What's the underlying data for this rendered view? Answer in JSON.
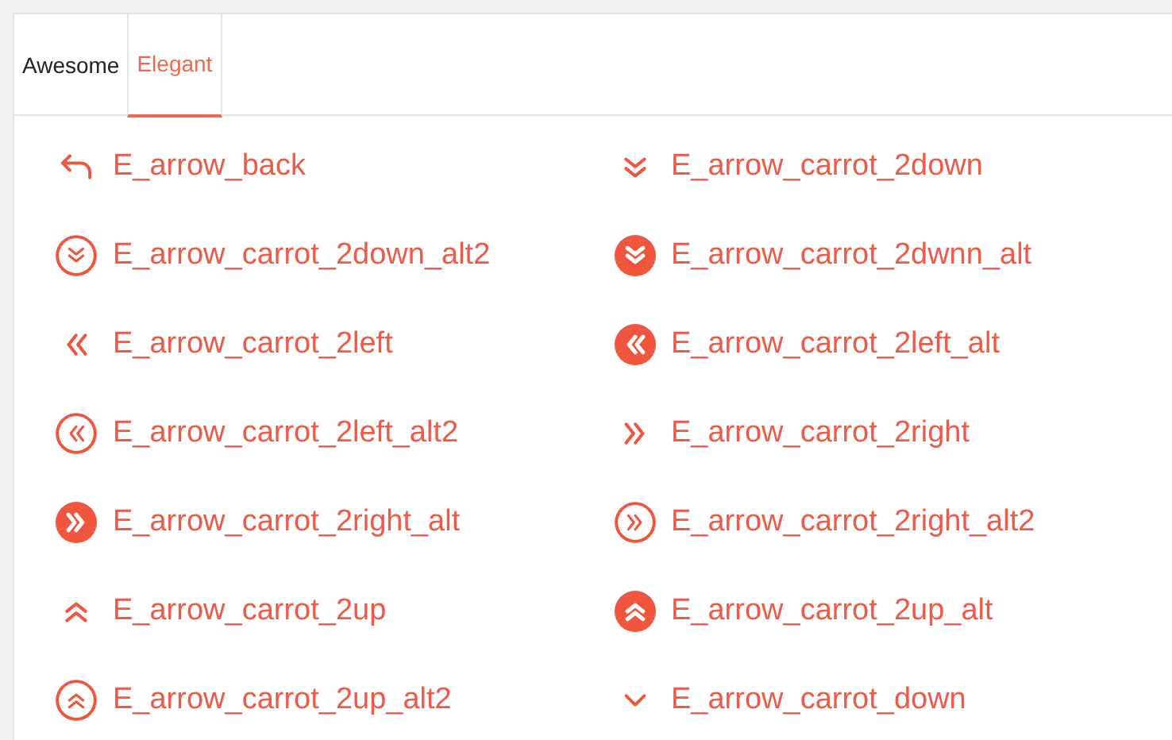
{
  "tabs": [
    {
      "label": "Awesome",
      "selected": false
    },
    {
      "label": "Elegant",
      "selected": true
    }
  ],
  "icons": [
    {
      "label": "E_arrow_back",
      "kind": "back"
    },
    {
      "label": "E_arrow_carrot_2down",
      "kind": "down"
    },
    {
      "label": "E_arrow_carrot_2down_alt2",
      "kind": "down-ring"
    },
    {
      "label": "E_arrow_carrot_2dwnn_alt",
      "kind": "down-disc"
    },
    {
      "label": "E_arrow_carrot_2left",
      "kind": "left"
    },
    {
      "label": "E_arrow_carrot_2left_alt",
      "kind": "left-disc"
    },
    {
      "label": "E_arrow_carrot_2left_alt2",
      "kind": "left-ring"
    },
    {
      "label": "E_arrow_carrot_2right",
      "kind": "right"
    },
    {
      "label": "E_arrow_carrot_2right_alt",
      "kind": "right-disc"
    },
    {
      "label": "E_arrow_carrot_2right_alt2",
      "kind": "right-ring"
    },
    {
      "label": "E_arrow_carrot_2up",
      "kind": "up"
    },
    {
      "label": "E_arrow_carrot_2up_alt",
      "kind": "up-disc"
    },
    {
      "label": "E_arrow_carrot_2up_alt2",
      "kind": "up-ring"
    },
    {
      "label": "E_arrow_carrot_down",
      "kind": "single-down"
    }
  ]
}
